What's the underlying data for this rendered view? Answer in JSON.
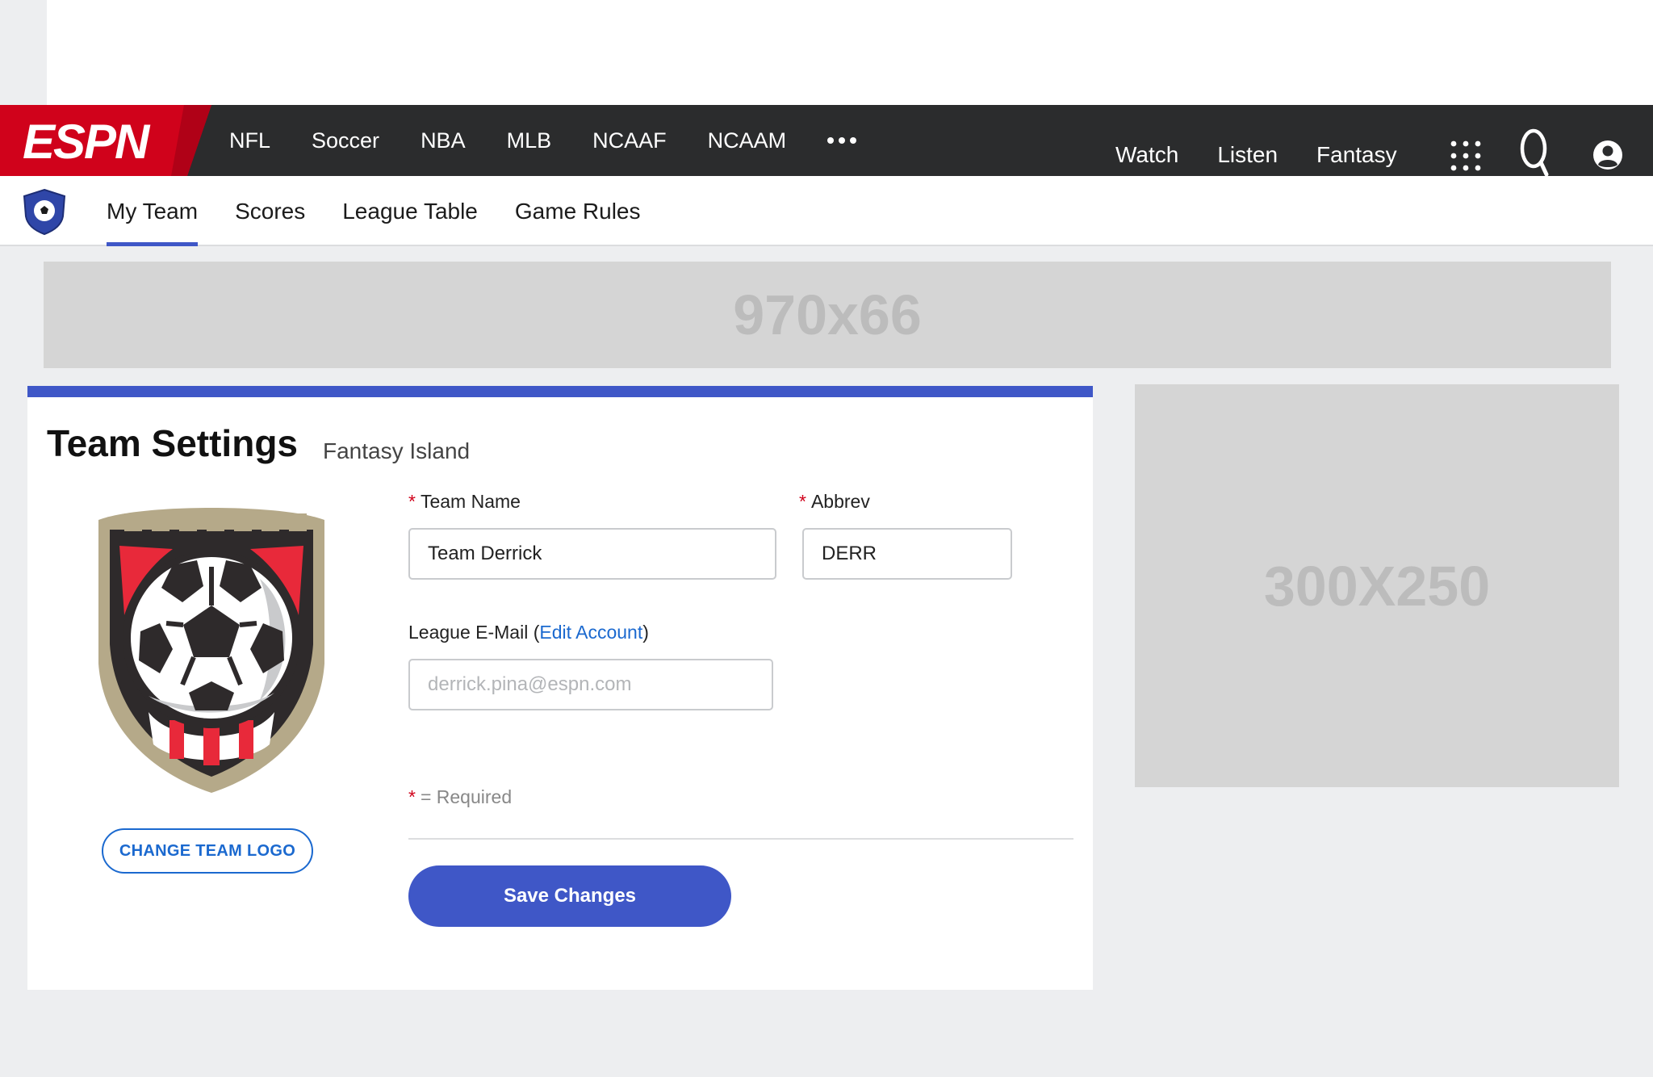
{
  "primary_nav": {
    "logo": "ESPN",
    "links": [
      "NFL",
      "Soccer",
      "NBA",
      "MLB",
      "NCAAF",
      "NCAAM"
    ],
    "more": "more-dots-icon",
    "right_links": [
      "Watch",
      "Listen",
      "Fantasy"
    ]
  },
  "sub_nav": {
    "tabs": [
      {
        "label": "My Team",
        "active": true
      },
      {
        "label": "Scores",
        "active": false
      },
      {
        "label": "League Table",
        "active": false
      },
      {
        "label": "Game Rules",
        "active": false
      }
    ]
  },
  "ads": {
    "top": "970x66",
    "side": "300X250"
  },
  "card": {
    "title": "Team Settings",
    "subtitle": "Fantasy Island",
    "change_logo_label": "CHANGE TEAM LOGO",
    "team_name_label": "Team Name",
    "team_name_value": "Team Derrick",
    "abbrev_label": "Abbrev",
    "abbrev_value": "DERR",
    "email_label_prefix": "League E-Mail (",
    "email_link": "Edit Account",
    "email_label_suffix": ")",
    "email_placeholder": "derrick.pina@espn.com",
    "required_mark": "*",
    "required_note": "= Required",
    "save_label": "Save Changes"
  },
  "colors": {
    "espn_red": "#d0021b",
    "nav_dark": "#2b2c2d",
    "accent_blue": "#3f57c7",
    "link_blue": "#1b69cf"
  }
}
